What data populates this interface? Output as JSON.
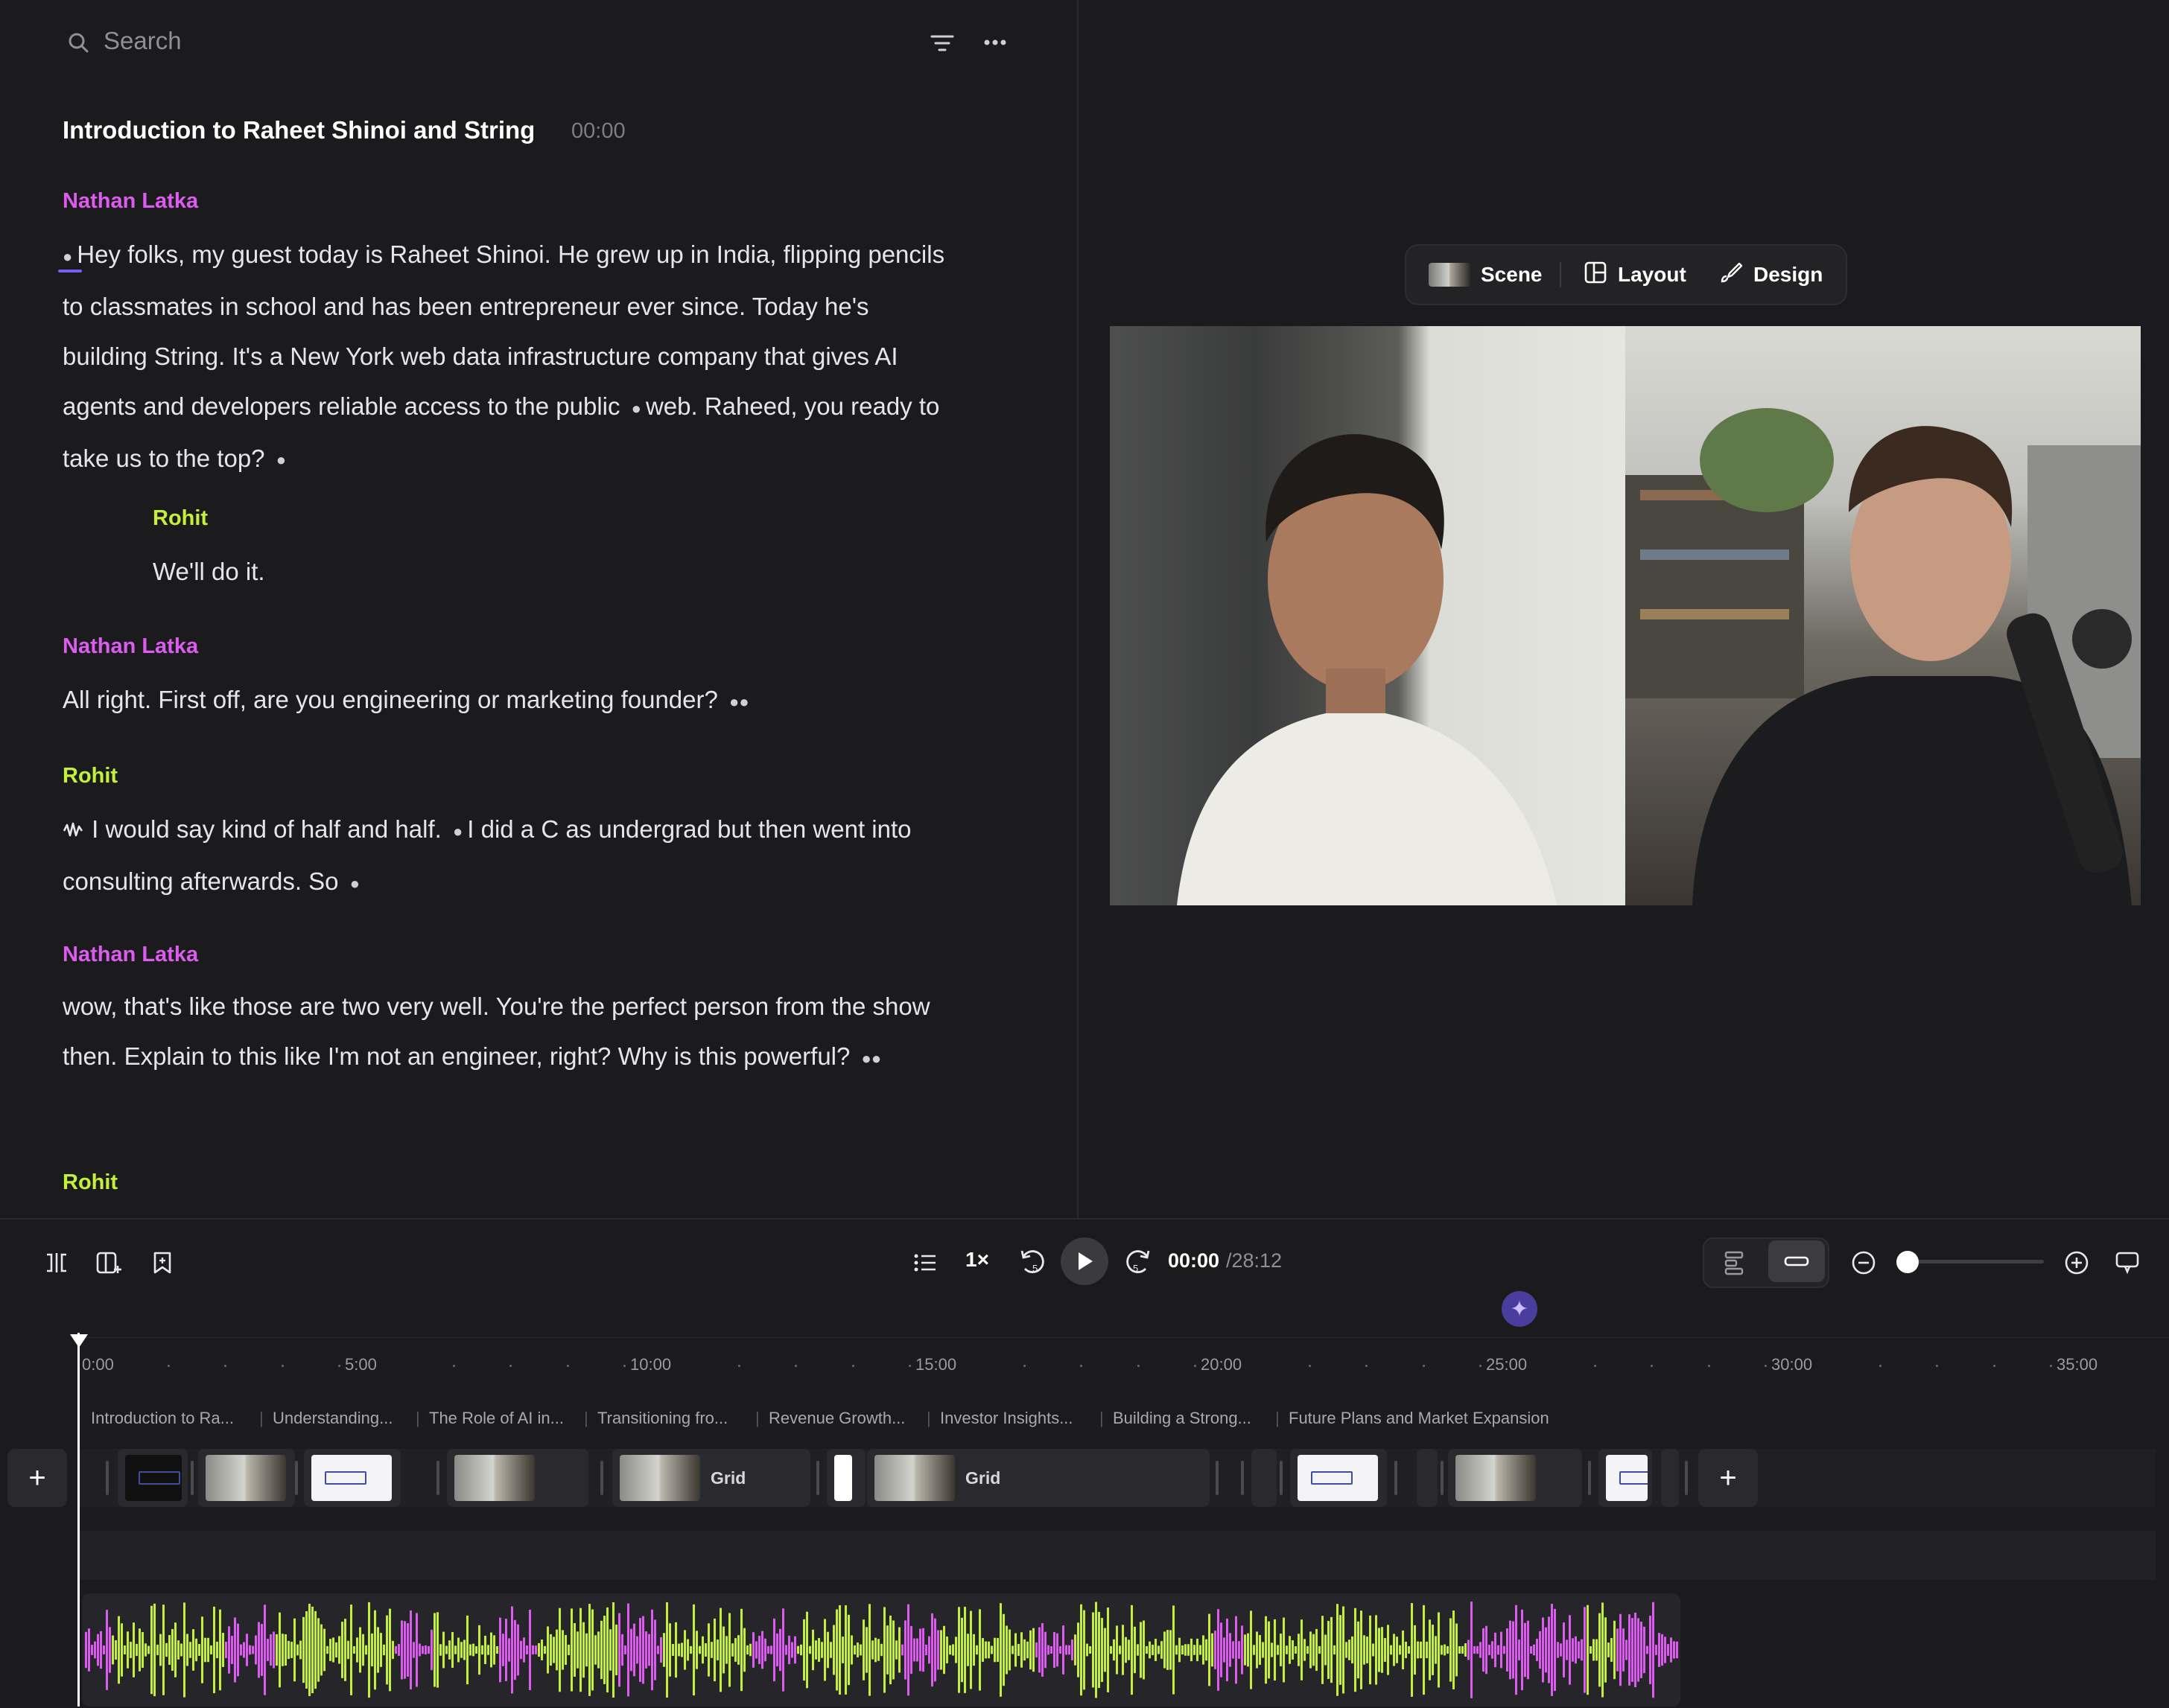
{
  "search": {
    "placeholder": "Search"
  },
  "chapter": {
    "title": "Introduction to Raheet Shinoi and String",
    "time": "00:00"
  },
  "colors": {
    "speaker_host": "#dc5cf0",
    "speaker_guest": "#c4f03c",
    "accent": "#4b3d9e"
  },
  "transcript": [
    {
      "speaker": "Nathan Latka",
      "text": "Hey folks, my guest today is Raheet Shinoi. He grew up in India, flipping pencils to classmates in school and has been entrepreneur ever since. Today he's building String. It's a New York web data infrastructure company that gives AI agents and developers reliable access to the public",
      "text_b": "web. Raheed, you ready to take us to the top?"
    },
    {
      "speaker": "Rohit",
      "text": "We'll do it."
    },
    {
      "speaker": "Nathan Latka",
      "text": "All right. First off, are you engineering or marketing founder?"
    },
    {
      "speaker": "Rohit",
      "text": "I would say kind of half and half.",
      "text_b": "I did a C as undergrad but then went into consulting afterwards. So"
    },
    {
      "speaker": "Nathan Latka",
      "text": "wow, that's like those are two very well. You're the perfect person from the show then. Explain to this like I'm not an engineer, right? Why is this powerful?"
    },
    {
      "speaker": "Rohit",
      "text": ""
    }
  ],
  "preview_toolbar": {
    "scene": "Scene",
    "layout": "Layout",
    "design": "Design"
  },
  "player": {
    "rate": "1×",
    "current_time": "00:00",
    "total_time": "/28:12",
    "rewind_seconds": "5",
    "forward_seconds": "5"
  },
  "ruler": [
    "0:00",
    "5:00",
    "10:00",
    "15:00",
    "20:00",
    "25:00",
    "30:00",
    "35:00"
  ],
  "chapters": [
    "Introduction to Ra...",
    "Understanding...",
    "The Role of AI in...",
    "Transitioning fro...",
    "Revenue Growth...",
    "Investor Insights...",
    "Building a Strong...",
    "Future Plans and Market Expansion"
  ],
  "clips": {
    "grid_label": "Grid"
  }
}
